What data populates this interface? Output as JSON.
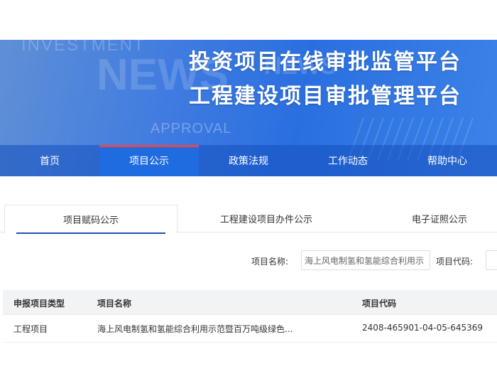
{
  "banner": {
    "bg_investment": "INVESTMENT",
    "bg_news": "NEWS",
    "bg_news2": "NEWS",
    "bg_approval": "APPROVAL",
    "title_line1": "投资项目在线审批监管平台",
    "title_line2": "工程建设项目审批管理平台"
  },
  "nav": {
    "items": [
      {
        "label": "首页"
      },
      {
        "label": "项目公示"
      },
      {
        "label": "政策法规"
      },
      {
        "label": "工作动态"
      },
      {
        "label": "帮助中心"
      }
    ],
    "active_index": 1
  },
  "tabs": {
    "items": [
      {
        "label": "项目赋码公示"
      },
      {
        "label": "工程建设项目办件公示"
      },
      {
        "label": "电子证照公示"
      }
    ],
    "active_index": 0
  },
  "search": {
    "name_label": "项目名称:",
    "name_value": "海上风电制氢和氢能综合利用示",
    "code_label": "项目代码:",
    "code_value": ""
  },
  "table": {
    "columns": [
      "申报项目类型",
      "项目名称",
      "项目代码"
    ],
    "rows": [
      {
        "type": "工程项目",
        "name": "海上风电制氢和氢能综合利用示范暨百万吨级绿色...",
        "code": "2408-465901-04-05-645369"
      }
    ]
  },
  "colors": {
    "banner_blue": "#2a6fe0",
    "nav_active": "#1f6be0",
    "nav_active_top": "#e5484d",
    "tab_underline": "#1f4fb5"
  }
}
